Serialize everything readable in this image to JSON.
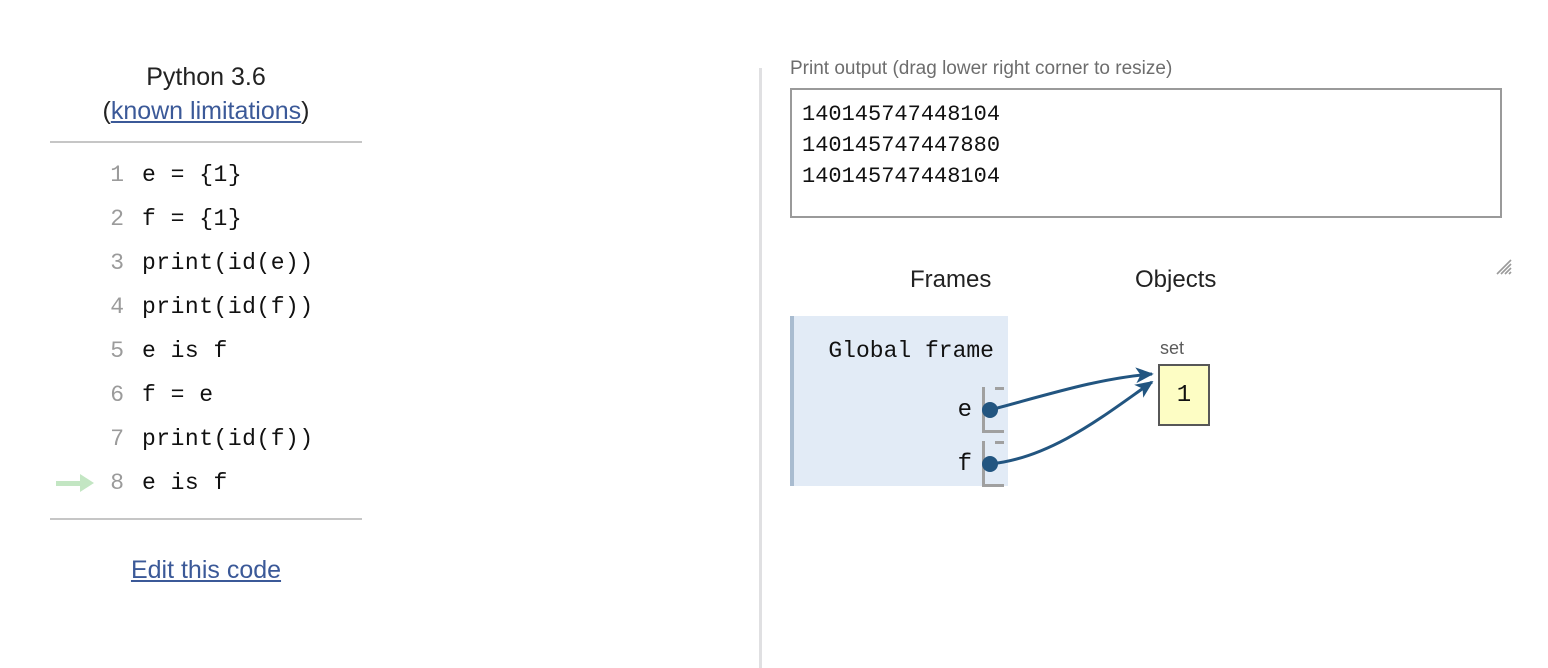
{
  "left_panel": {
    "python_version": "Python 3.6",
    "limitations_prefix": "(",
    "limitations_link": "known limitations",
    "limitations_suffix": ")",
    "edit_link": "Edit this code",
    "current_line": 8,
    "code_lines": [
      {
        "num": "1",
        "text": "e = {1}"
      },
      {
        "num": "2",
        "text": "f = {1}"
      },
      {
        "num": "3",
        "text": "print(id(e))"
      },
      {
        "num": "4",
        "text": "print(id(f))"
      },
      {
        "num": "5",
        "text": "e is f"
      },
      {
        "num": "6",
        "text": "f = e"
      },
      {
        "num": "7",
        "text": "print(id(f))"
      },
      {
        "num": "8",
        "text": "e is f"
      }
    ]
  },
  "right_panel": {
    "output_label": "Print output (drag lower right corner to resize)",
    "output_text": "140145747448104\n140145747447880\n140145747448104",
    "resize_grip_icon": "resize-grip-icon",
    "headings": {
      "frames": "Frames",
      "objects": "Objects"
    },
    "frame": {
      "title": "Global frame",
      "variables": [
        {
          "name": "e",
          "points_to": "set-object"
        },
        {
          "name": "f",
          "points_to": "set-object"
        }
      ]
    },
    "objects": [
      {
        "type": "set",
        "value": "1"
      }
    ]
  },
  "colors": {
    "link": "#3b5998",
    "frame_bg": "#e2ebf6",
    "frame_border": "#a9bcd0",
    "object_bg": "#fdfdc4",
    "object_border": "#575757",
    "pointer": "#225580",
    "highlight_arrow": "#c3e6c3",
    "line_number": "#9b9b9b",
    "divider": "#e0e0e2"
  }
}
